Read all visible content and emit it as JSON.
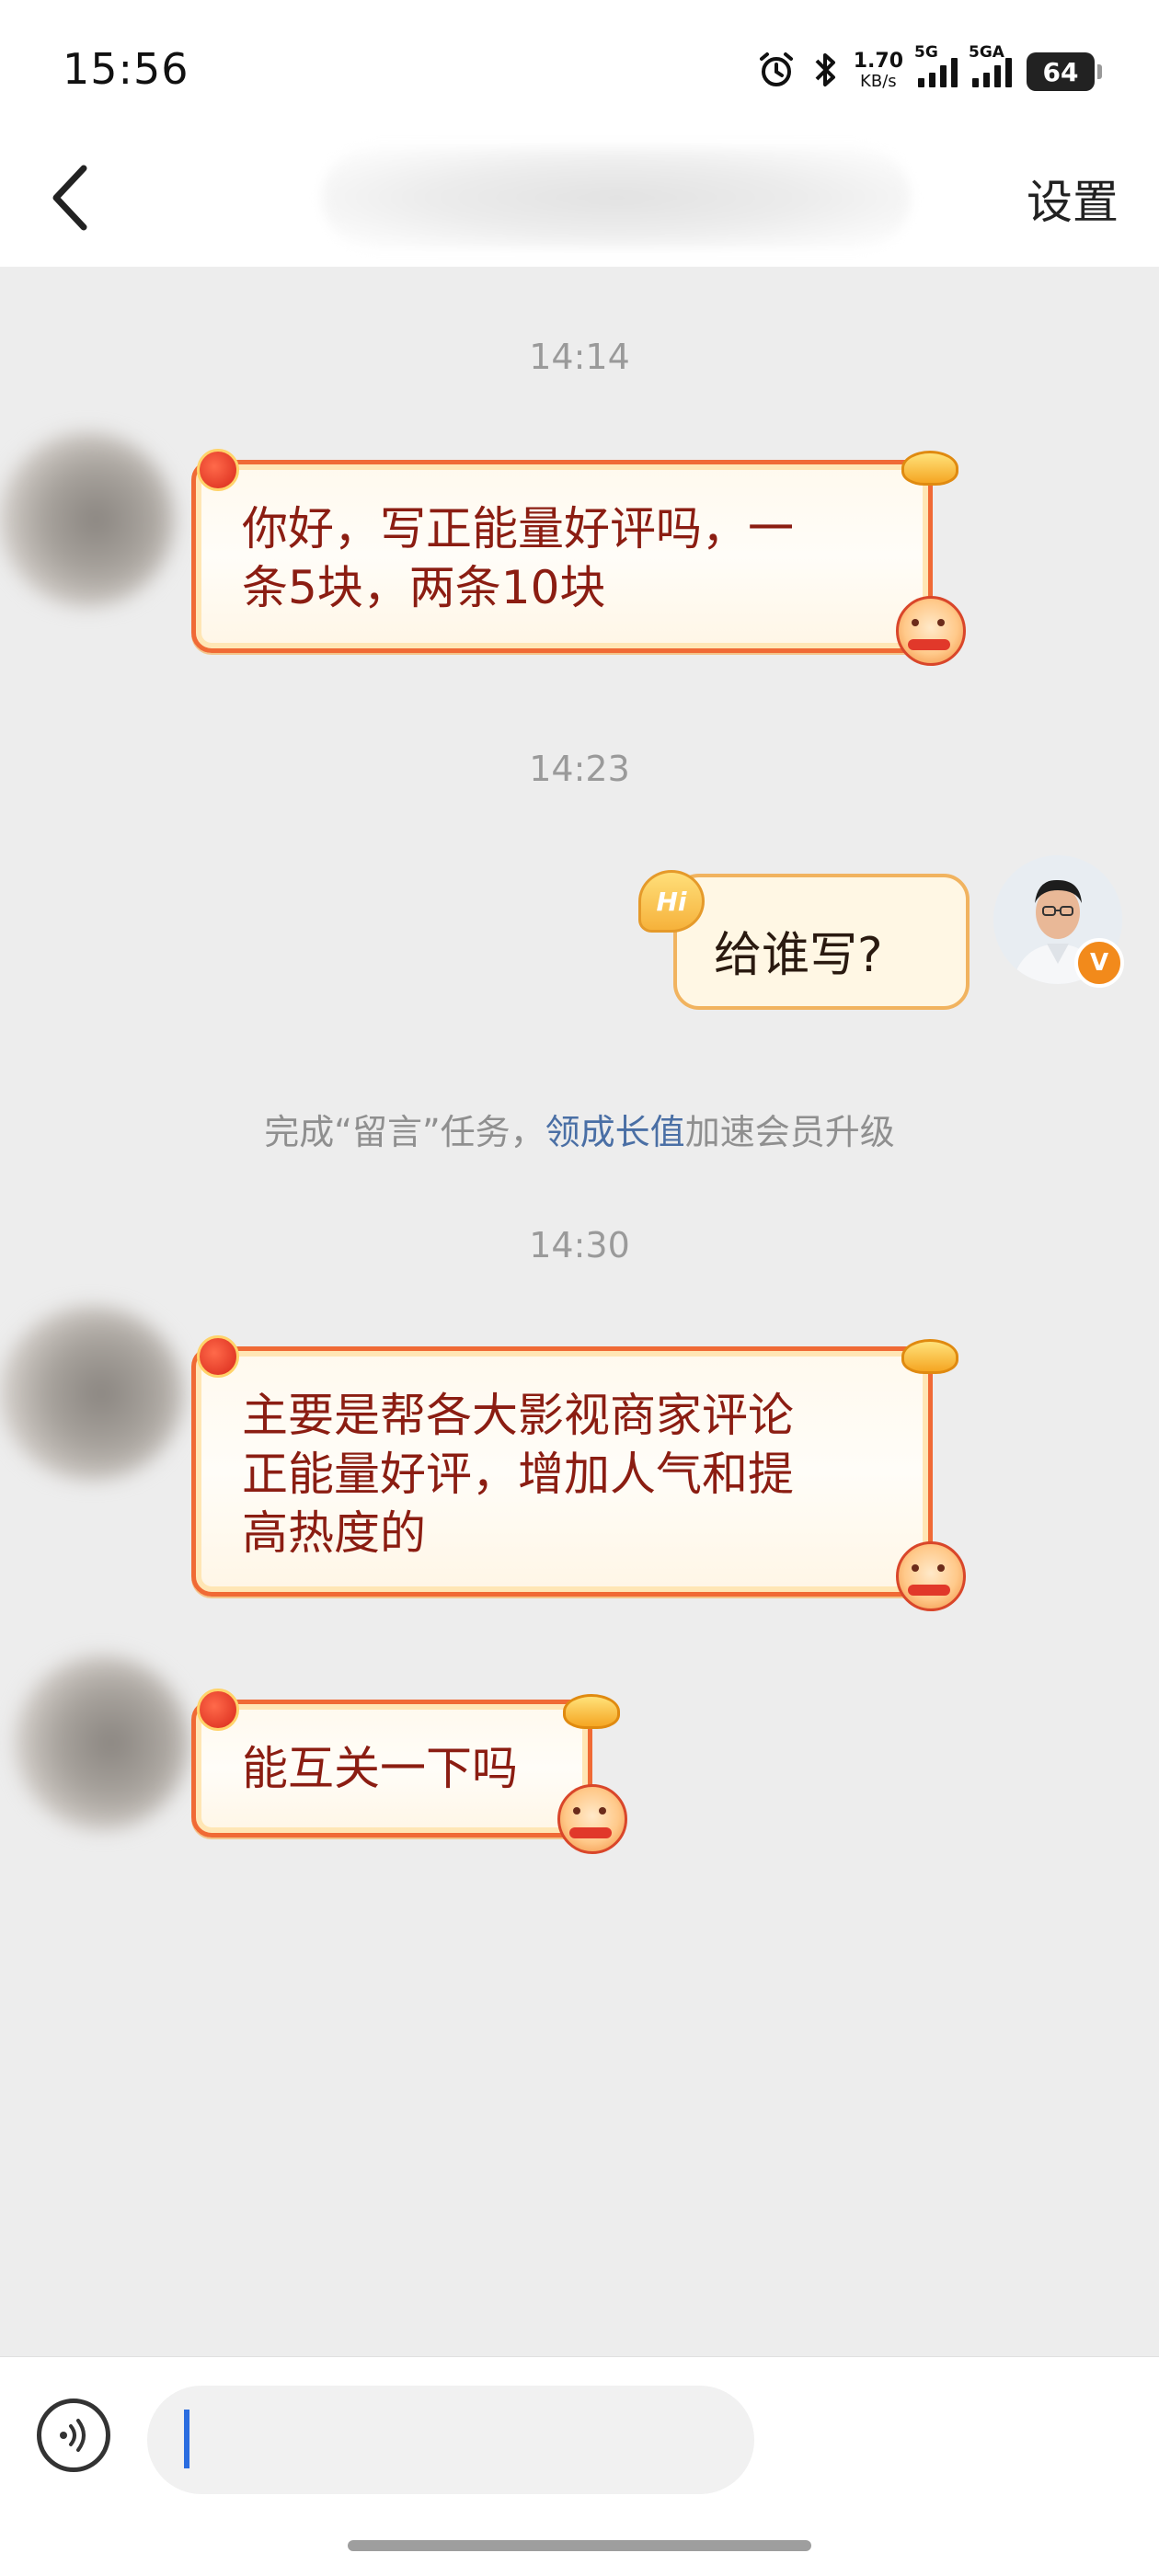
{
  "status_bar": {
    "time": "15:56",
    "net_speed_value": "1.70",
    "net_speed_unit": "KB/s",
    "sim1_label": "5G",
    "sim2_label": "5GA",
    "battery": "64",
    "icons": [
      "alarm-icon",
      "bluetooth-icon",
      "signal-icon",
      "signal-icon",
      "battery-icon"
    ]
  },
  "nav": {
    "back_icon": "chevron-left-icon",
    "settings_label": "设置"
  },
  "messages": [
    {
      "time": "14:14"
    },
    {
      "direction": "incoming",
      "text": "你好，写正能量好评吗，一\n条5块，两条10块"
    },
    {
      "time": "14:23"
    },
    {
      "direction": "outgoing",
      "text": "给谁写?"
    },
    {
      "time": "14:30"
    },
    {
      "direction": "incoming",
      "text": "主要是帮各大影视商家评论\n正能量好评，增加人气和提\n高热度的"
    },
    {
      "direction": "incoming",
      "text": "能互关一下吗"
    }
  ],
  "outgoing_badge": "Hi",
  "verified_badge": "V",
  "system_notice": {
    "prefix": "完成“留言”任务，",
    "link": "领成长值",
    "suffix": "加速会员升级"
  },
  "input": {
    "voice_icon": "voice-icon",
    "value": ""
  }
}
